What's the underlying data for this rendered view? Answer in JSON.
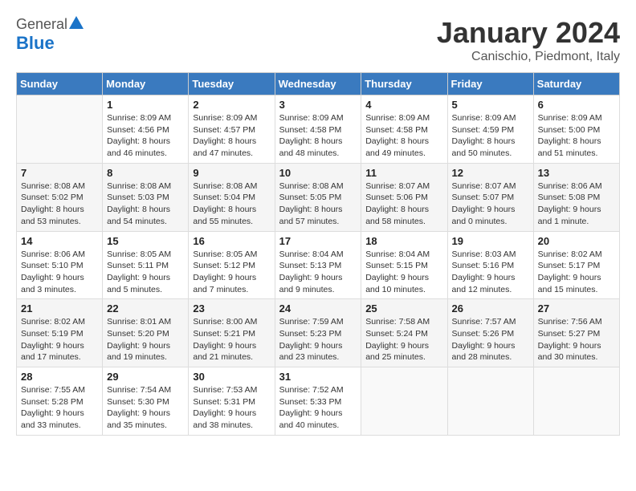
{
  "header": {
    "logo_general": "General",
    "logo_blue": "Blue",
    "month_title": "January 2024",
    "subtitle": "Canischio, Piedmont, Italy"
  },
  "days_of_week": [
    "Sunday",
    "Monday",
    "Tuesday",
    "Wednesday",
    "Thursday",
    "Friday",
    "Saturday"
  ],
  "weeks": [
    [
      {
        "day": "",
        "sunrise": "",
        "sunset": "",
        "daylight": ""
      },
      {
        "day": "1",
        "sunrise": "Sunrise: 8:09 AM",
        "sunset": "Sunset: 4:56 PM",
        "daylight": "Daylight: 8 hours and 46 minutes."
      },
      {
        "day": "2",
        "sunrise": "Sunrise: 8:09 AM",
        "sunset": "Sunset: 4:57 PM",
        "daylight": "Daylight: 8 hours and 47 minutes."
      },
      {
        "day": "3",
        "sunrise": "Sunrise: 8:09 AM",
        "sunset": "Sunset: 4:58 PM",
        "daylight": "Daylight: 8 hours and 48 minutes."
      },
      {
        "day": "4",
        "sunrise": "Sunrise: 8:09 AM",
        "sunset": "Sunset: 4:58 PM",
        "daylight": "Daylight: 8 hours and 49 minutes."
      },
      {
        "day": "5",
        "sunrise": "Sunrise: 8:09 AM",
        "sunset": "Sunset: 4:59 PM",
        "daylight": "Daylight: 8 hours and 50 minutes."
      },
      {
        "day": "6",
        "sunrise": "Sunrise: 8:09 AM",
        "sunset": "Sunset: 5:00 PM",
        "daylight": "Daylight: 8 hours and 51 minutes."
      }
    ],
    [
      {
        "day": "7",
        "sunrise": "Sunrise: 8:08 AM",
        "sunset": "Sunset: 5:02 PM",
        "daylight": "Daylight: 8 hours and 53 minutes."
      },
      {
        "day": "8",
        "sunrise": "Sunrise: 8:08 AM",
        "sunset": "Sunset: 5:03 PM",
        "daylight": "Daylight: 8 hours and 54 minutes."
      },
      {
        "day": "9",
        "sunrise": "Sunrise: 8:08 AM",
        "sunset": "Sunset: 5:04 PM",
        "daylight": "Daylight: 8 hours and 55 minutes."
      },
      {
        "day": "10",
        "sunrise": "Sunrise: 8:08 AM",
        "sunset": "Sunset: 5:05 PM",
        "daylight": "Daylight: 8 hours and 57 minutes."
      },
      {
        "day": "11",
        "sunrise": "Sunrise: 8:07 AM",
        "sunset": "Sunset: 5:06 PM",
        "daylight": "Daylight: 8 hours and 58 minutes."
      },
      {
        "day": "12",
        "sunrise": "Sunrise: 8:07 AM",
        "sunset": "Sunset: 5:07 PM",
        "daylight": "Daylight: 9 hours and 0 minutes."
      },
      {
        "day": "13",
        "sunrise": "Sunrise: 8:06 AM",
        "sunset": "Sunset: 5:08 PM",
        "daylight": "Daylight: 9 hours and 1 minute."
      }
    ],
    [
      {
        "day": "14",
        "sunrise": "Sunrise: 8:06 AM",
        "sunset": "Sunset: 5:10 PM",
        "daylight": "Daylight: 9 hours and 3 minutes."
      },
      {
        "day": "15",
        "sunrise": "Sunrise: 8:05 AM",
        "sunset": "Sunset: 5:11 PM",
        "daylight": "Daylight: 9 hours and 5 minutes."
      },
      {
        "day": "16",
        "sunrise": "Sunrise: 8:05 AM",
        "sunset": "Sunset: 5:12 PM",
        "daylight": "Daylight: 9 hours and 7 minutes."
      },
      {
        "day": "17",
        "sunrise": "Sunrise: 8:04 AM",
        "sunset": "Sunset: 5:13 PM",
        "daylight": "Daylight: 9 hours and 9 minutes."
      },
      {
        "day": "18",
        "sunrise": "Sunrise: 8:04 AM",
        "sunset": "Sunset: 5:15 PM",
        "daylight": "Daylight: 9 hours and 10 minutes."
      },
      {
        "day": "19",
        "sunrise": "Sunrise: 8:03 AM",
        "sunset": "Sunset: 5:16 PM",
        "daylight": "Daylight: 9 hours and 12 minutes."
      },
      {
        "day": "20",
        "sunrise": "Sunrise: 8:02 AM",
        "sunset": "Sunset: 5:17 PM",
        "daylight": "Daylight: 9 hours and 15 minutes."
      }
    ],
    [
      {
        "day": "21",
        "sunrise": "Sunrise: 8:02 AM",
        "sunset": "Sunset: 5:19 PM",
        "daylight": "Daylight: 9 hours and 17 minutes."
      },
      {
        "day": "22",
        "sunrise": "Sunrise: 8:01 AM",
        "sunset": "Sunset: 5:20 PM",
        "daylight": "Daylight: 9 hours and 19 minutes."
      },
      {
        "day": "23",
        "sunrise": "Sunrise: 8:00 AM",
        "sunset": "Sunset: 5:21 PM",
        "daylight": "Daylight: 9 hours and 21 minutes."
      },
      {
        "day": "24",
        "sunrise": "Sunrise: 7:59 AM",
        "sunset": "Sunset: 5:23 PM",
        "daylight": "Daylight: 9 hours and 23 minutes."
      },
      {
        "day": "25",
        "sunrise": "Sunrise: 7:58 AM",
        "sunset": "Sunset: 5:24 PM",
        "daylight": "Daylight: 9 hours and 25 minutes."
      },
      {
        "day": "26",
        "sunrise": "Sunrise: 7:57 AM",
        "sunset": "Sunset: 5:26 PM",
        "daylight": "Daylight: 9 hours and 28 minutes."
      },
      {
        "day": "27",
        "sunrise": "Sunrise: 7:56 AM",
        "sunset": "Sunset: 5:27 PM",
        "daylight": "Daylight: 9 hours and 30 minutes."
      }
    ],
    [
      {
        "day": "28",
        "sunrise": "Sunrise: 7:55 AM",
        "sunset": "Sunset: 5:28 PM",
        "daylight": "Daylight: 9 hours and 33 minutes."
      },
      {
        "day": "29",
        "sunrise": "Sunrise: 7:54 AM",
        "sunset": "Sunset: 5:30 PM",
        "daylight": "Daylight: 9 hours and 35 minutes."
      },
      {
        "day": "30",
        "sunrise": "Sunrise: 7:53 AM",
        "sunset": "Sunset: 5:31 PM",
        "daylight": "Daylight: 9 hours and 38 minutes."
      },
      {
        "day": "31",
        "sunrise": "Sunrise: 7:52 AM",
        "sunset": "Sunset: 5:33 PM",
        "daylight": "Daylight: 9 hours and 40 minutes."
      },
      {
        "day": "",
        "sunrise": "",
        "sunset": "",
        "daylight": ""
      },
      {
        "day": "",
        "sunrise": "",
        "sunset": "",
        "daylight": ""
      },
      {
        "day": "",
        "sunrise": "",
        "sunset": "",
        "daylight": ""
      }
    ]
  ]
}
